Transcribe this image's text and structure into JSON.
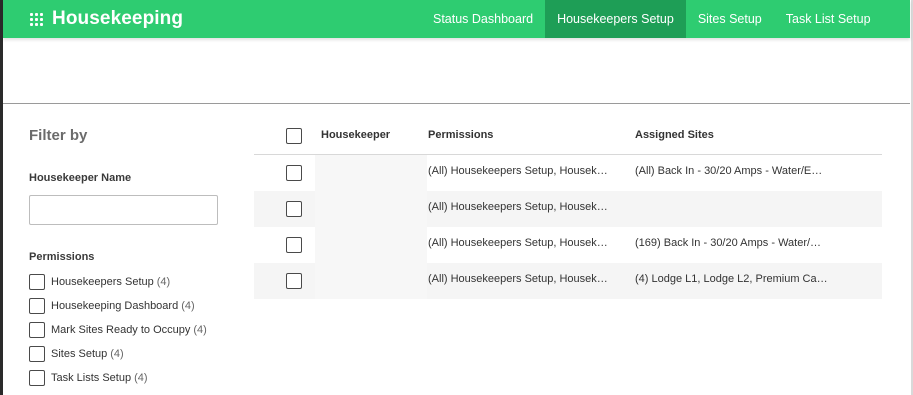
{
  "app": {
    "title": "Housekeeping"
  },
  "nav": {
    "items": [
      {
        "label": "Status Dashboard",
        "active": false
      },
      {
        "label": "Housekeepers Setup",
        "active": true
      },
      {
        "label": "Sites Setup",
        "active": false
      },
      {
        "label": "Task List Setup",
        "active": false
      }
    ]
  },
  "filter": {
    "title": "Filter by",
    "name_label": "Housekeeper Name",
    "name_value": "",
    "name_placeholder": "",
    "permissions_label": "Permissions",
    "permissions": [
      {
        "label": "Housekeepers Setup",
        "count": "(4)",
        "checked": false
      },
      {
        "label": "Housekeeping Dashboard",
        "count": "(4)",
        "checked": false
      },
      {
        "label": "Mark Sites Ready to Occupy",
        "count": "(4)",
        "checked": false
      },
      {
        "label": "Sites Setup",
        "count": "(4)",
        "checked": false
      },
      {
        "label": "Task Lists Setup",
        "count": "(4)",
        "checked": false
      }
    ]
  },
  "table": {
    "columns": [
      "Housekeeper",
      "Permissions",
      "Assigned Sites"
    ],
    "rows": [
      {
        "housekeeper": "",
        "permissions": "(All) Housekeepers Setup, Housek…",
        "sites": "(All) Back In - 30/20 Amps - Water/E…"
      },
      {
        "housekeeper": "",
        "permissions": "(All) Housekeepers Setup, Housek…",
        "sites": ""
      },
      {
        "housekeeper": "",
        "permissions": "(All) Housekeepers Setup, Housek…",
        "sites": "(169) Back In - 30/20 Amps - Water/…"
      },
      {
        "housekeeper": "",
        "permissions": "(All) Housekeepers Setup, Housek…",
        "sites": "(4) Lodge L1, Lodge L2, Premium Ca…"
      }
    ]
  },
  "colors": {
    "header_bg": "#2ecc71",
    "active_tab_bg": "#1e9e56",
    "header_text": "#ffffff"
  }
}
